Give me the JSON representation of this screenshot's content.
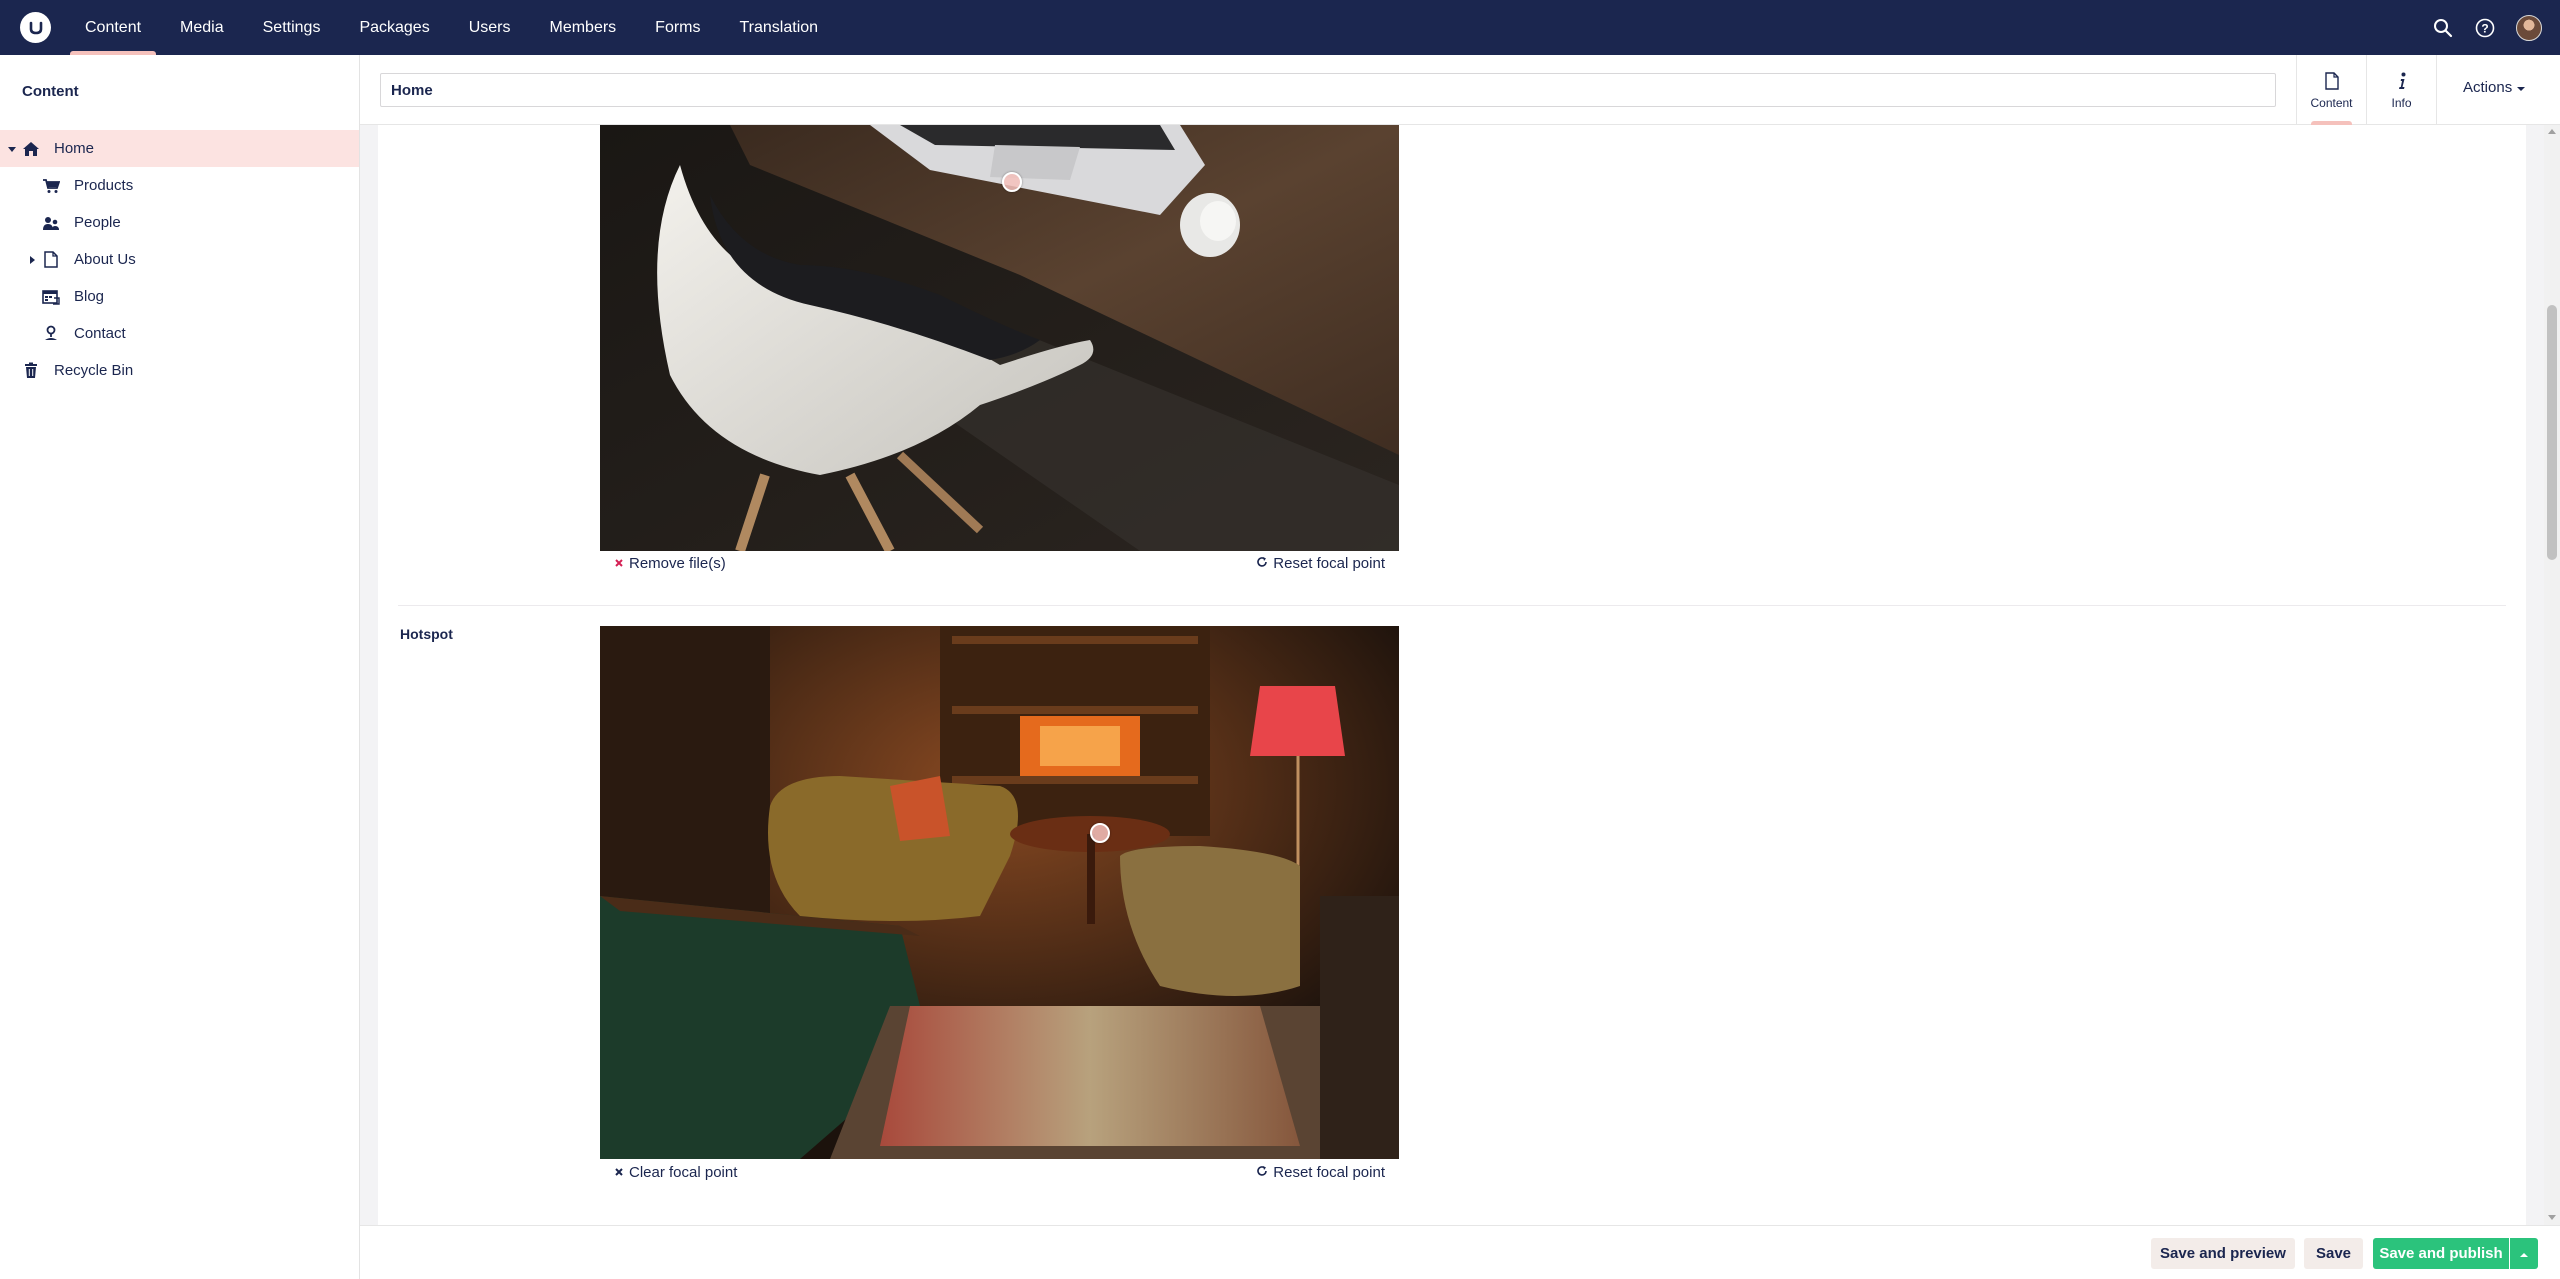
{
  "topbar": {
    "logo_icon": "umbraco-logo-icon",
    "nav": [
      {
        "label": "Content",
        "active": true
      },
      {
        "label": "Media"
      },
      {
        "label": "Settings"
      },
      {
        "label": "Packages"
      },
      {
        "label": "Users"
      },
      {
        "label": "Members"
      },
      {
        "label": "Forms"
      },
      {
        "label": "Translation"
      }
    ],
    "icons": [
      "search-icon",
      "help-icon",
      "user-avatar"
    ]
  },
  "sidebar": {
    "title": "Content",
    "tree": [
      {
        "label": "Home",
        "icon": "home-icon",
        "selected": true,
        "expanded": true
      },
      {
        "label": "Products",
        "icon": "shopping-cart-icon"
      },
      {
        "label": "People",
        "icon": "people-icon"
      },
      {
        "label": "About Us",
        "icon": "document-icon",
        "has_children": true
      },
      {
        "label": "Blog",
        "icon": "calendar-news-icon"
      },
      {
        "label": "Contact",
        "icon": "map-pin-icon"
      },
      {
        "label": "Recycle Bin",
        "icon": "trash-icon"
      }
    ]
  },
  "header": {
    "name_value": "Home",
    "tabs": [
      {
        "label": "Content",
        "icon": "document-icon",
        "active": true
      },
      {
        "label": "Info",
        "icon": "info-icon"
      }
    ],
    "actions_label": "Actions"
  },
  "editor": {
    "image1": {
      "remove_label": "Remove file(s)",
      "reset_label": "Reset focal point"
    },
    "hotspot": {
      "label": "Hotspot",
      "clear_label": "Clear focal point",
      "reset_label": "Reset focal point"
    }
  },
  "footer": {
    "save_preview_label": "Save and preview",
    "save_label": "Save",
    "publish_label": "Save and publish"
  },
  "colors": {
    "topbar": "#1b264f",
    "accent": "#f5c1bc",
    "selected_bg": "#fce3e1",
    "publish": "#2bc37c"
  }
}
